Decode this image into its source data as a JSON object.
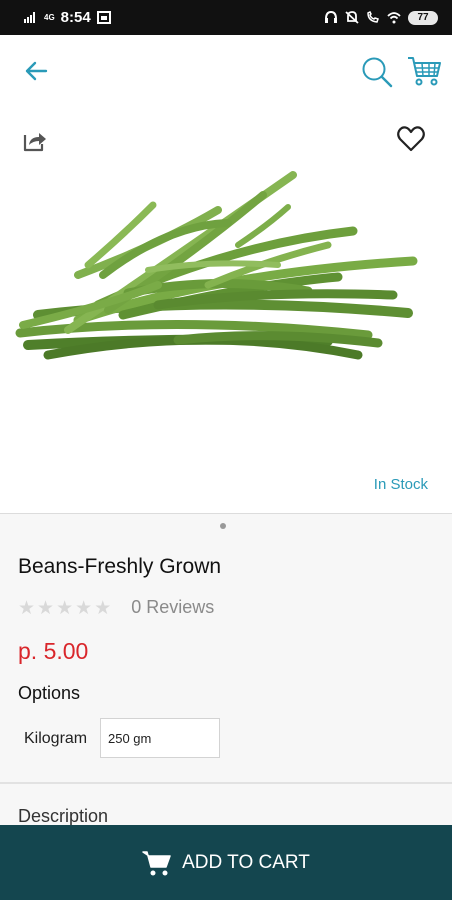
{
  "status_bar": {
    "time": "8:54",
    "network": "4G",
    "battery": "77",
    "icons": [
      "signal-icon",
      "photo-icon",
      "headset-icon",
      "mute-icon",
      "call-icon",
      "wifi-icon",
      "battery-icon"
    ]
  },
  "app_bar": {
    "icons": [
      "back-arrow-icon",
      "search-icon",
      "shopping-cart-icon"
    ],
    "accent_color": "#2a9ab8"
  },
  "product": {
    "image_icons": [
      "share-icon",
      "heart-icon"
    ],
    "stock_status": "In Stock",
    "title": "Beans-Freshly Grown",
    "rating": 0,
    "reviews": "0 Reviews",
    "price": "p. 5.00",
    "price_color": "#d9262b",
    "options_title": "Options",
    "option": {
      "label": "Kilogram",
      "value": "250 gm"
    },
    "description_title": "Description"
  },
  "bottom_bar": {
    "label": "ADD TO CART",
    "icon": "cart-icon",
    "color": "#14464f"
  }
}
